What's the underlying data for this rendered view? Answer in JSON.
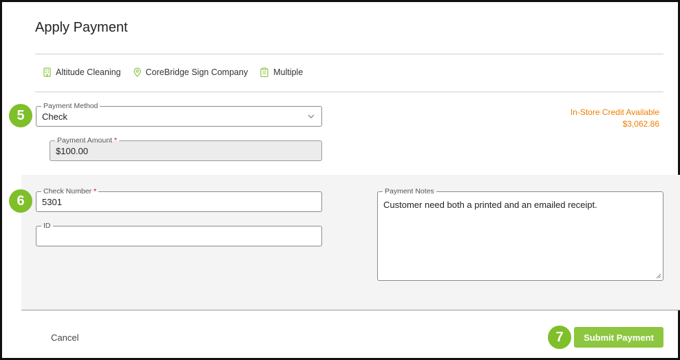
{
  "dialog": {
    "title": "Apply Payment"
  },
  "meta": {
    "company": "Altitude Cleaning",
    "location": "CoreBridge Sign Company",
    "orders": "Multiple"
  },
  "payment_method": {
    "label": "Payment Method",
    "value": "Check"
  },
  "payment_amount": {
    "label": "Payment Amount",
    "required_mark": "*",
    "value": "$100.00"
  },
  "credit": {
    "label": "In-Store Credit Available",
    "amount": "$3,062.86"
  },
  "check_number": {
    "label": "Check Number",
    "required_mark": "*",
    "value": "5301"
  },
  "id_field": {
    "label": "ID",
    "value": ""
  },
  "payment_notes": {
    "label": "Payment Notes",
    "value": "Customer need both a printed and an emailed receipt."
  },
  "steps": {
    "method_step": "5",
    "check_step": "6",
    "submit_step": "7"
  },
  "footer": {
    "cancel_label": "Cancel",
    "submit_label": "Submit Payment"
  },
  "colors": {
    "accent_green": "#8dc63f",
    "step_green": "#7fbf2a",
    "credit_orange": "#ef7d00",
    "required_red": "#d0021b"
  },
  "icons": {
    "company": "building-icon",
    "location": "map-pin-icon",
    "orders": "clipboard-icon",
    "dropdown": "chevron-down-icon"
  }
}
